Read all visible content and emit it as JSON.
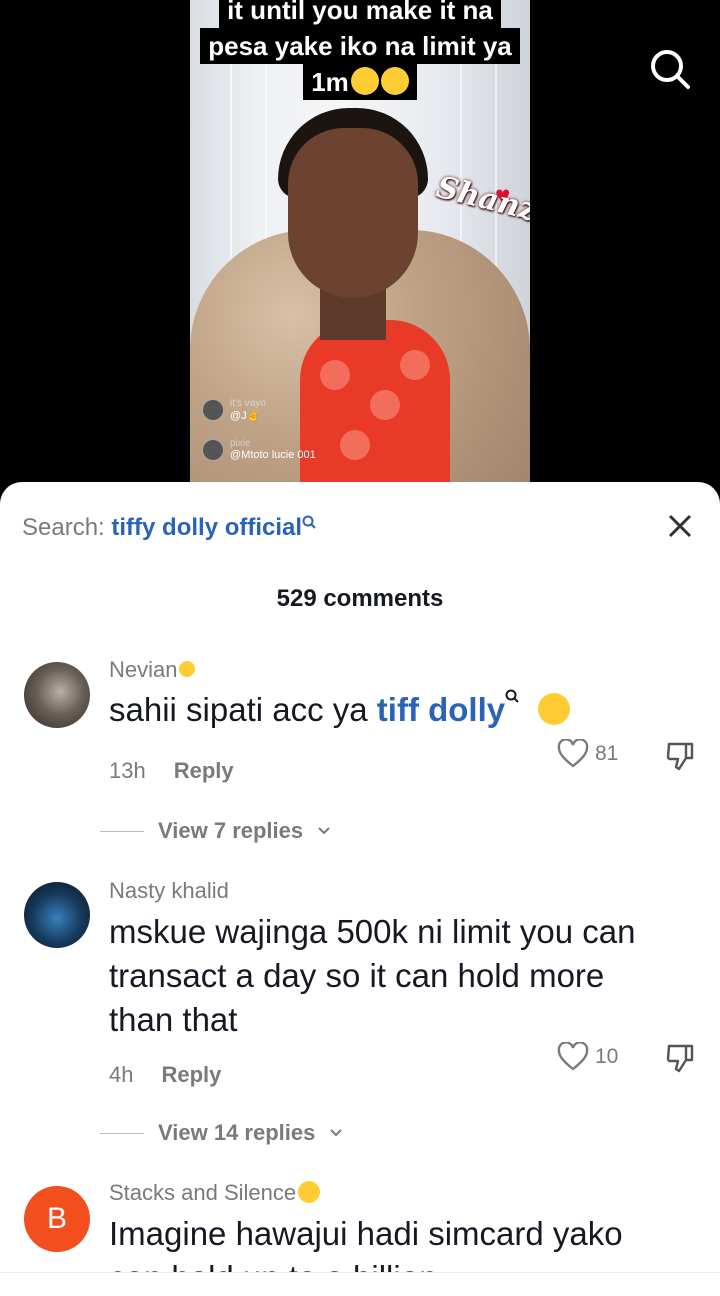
{
  "video": {
    "caption_lines": [
      "it until you make it na",
      "pesa yake iko na limit ya",
      "1m"
    ],
    "watermark": "Shanzey",
    "overlay_users": [
      {
        "name": "it's vayo",
        "handle": "@J✌️"
      },
      {
        "name": "pixie",
        "handle": "@Mtoto lucie 001"
      }
    ]
  },
  "sheet": {
    "search_prefix": "Search:",
    "search_term": "tiffy dolly official",
    "comment_count": "529 comments"
  },
  "comments": [
    {
      "username": "Nevian",
      "text_prefix": "sahii sipati acc ya ",
      "text_link": "tiff dolly",
      "time": "13h",
      "reply_label": "Reply",
      "likes": "81",
      "view_replies": "View 7 replies"
    },
    {
      "username": "Nasty khalid",
      "text": "mskue wajinga 500k ni limit you can transact a day so it can hold more than that",
      "time": "4h",
      "reply_label": "Reply",
      "likes": "10",
      "view_replies": "View 14 replies"
    },
    {
      "username": "Stacks and Silence",
      "avatar_letter": "B",
      "text": "Imagine hawajui hadi simcard yako can hold up to a billion"
    }
  ],
  "icons": {
    "search": "search-icon",
    "close": "close-icon",
    "like": "heart-outline-icon",
    "dislike": "thumbs-down-icon",
    "chevron": "chevron-down-icon"
  },
  "colors": {
    "link_blue": "#2a63b8",
    "muted_text": "#7a7a7a",
    "avatar_b": "#f24e1e"
  }
}
